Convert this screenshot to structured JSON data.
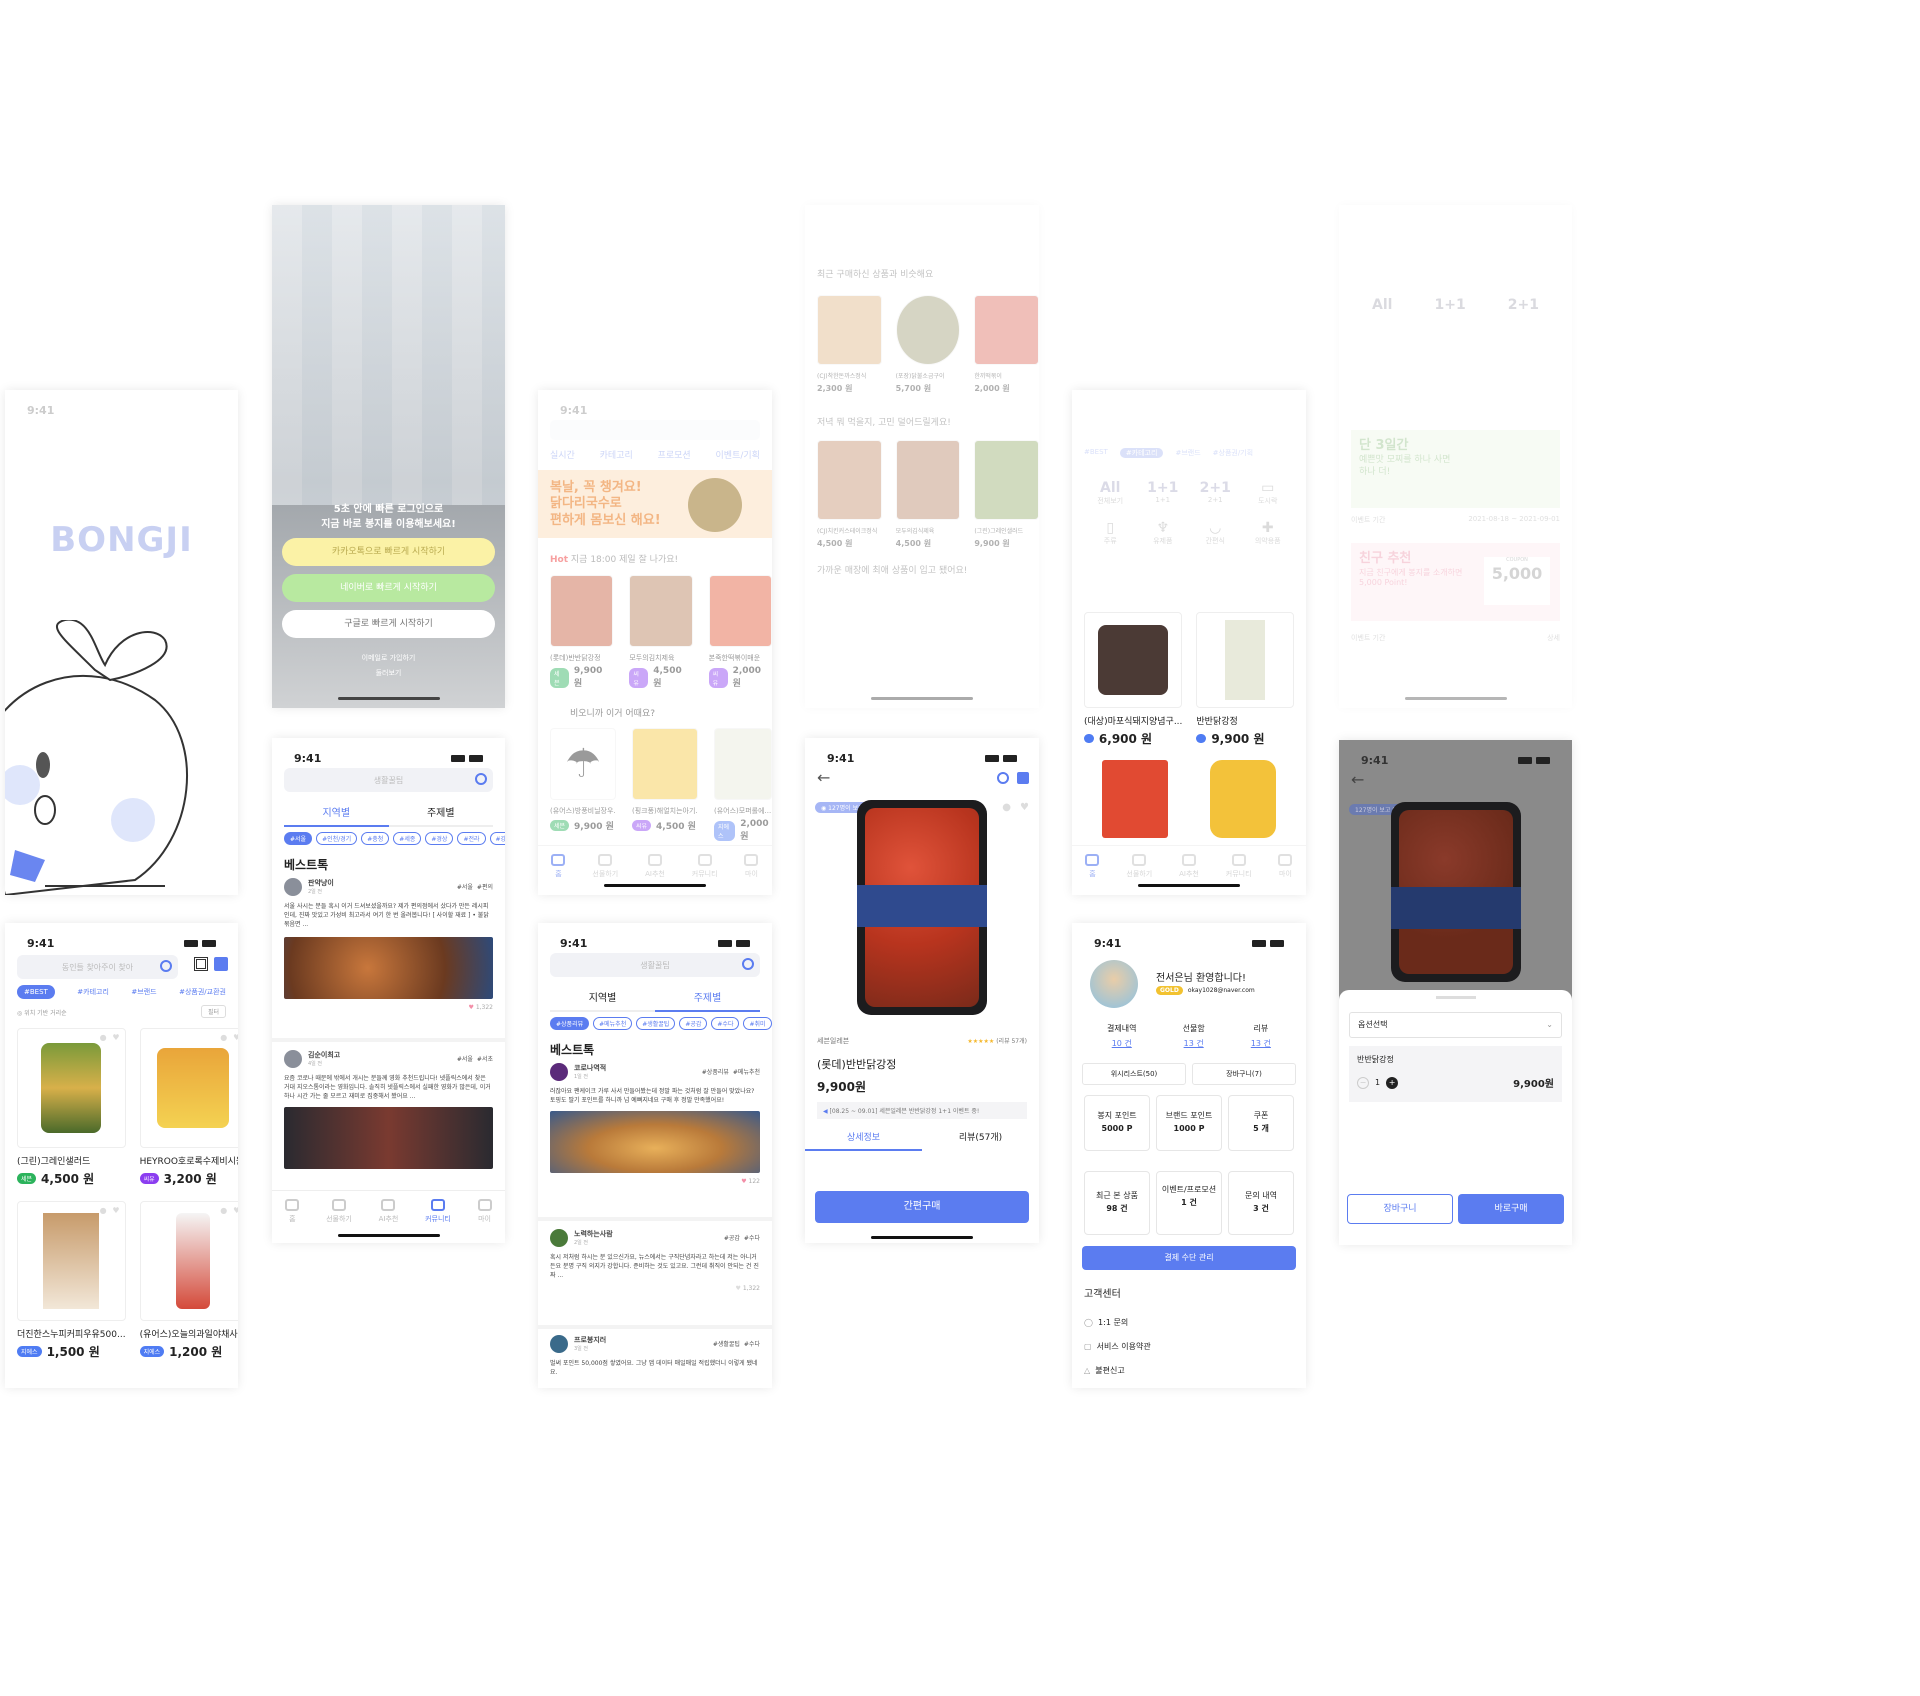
{
  "status_time": "9:41",
  "splash": {
    "logo": "BONGJI"
  },
  "login": {
    "headline1": "5초 안에 빠른 로그인으로",
    "headline2": "지금 바로 봉지를 이용해보세요!",
    "kakao": "카카오톡으로 빠르게 시작하기",
    "naver": "네이버로 빠르게 시작하기",
    "google": "구글로 빠르게 시작하기",
    "email_signup": "이메일로 가입하기",
    "browse": "둘러보기"
  },
  "home": {
    "search_placeholder": "동인들 찾아주이 찾아",
    "tabs": [
      "#BEST",
      "#카테고리",
      "#브랜드",
      "#상품권/교환권"
    ],
    "location": "위치 기반 거리순",
    "filter": "필터",
    "products": [
      {
        "name": "(그린)그레인샐러드",
        "price": "4,500 원",
        "badge": "세븐"
      },
      {
        "name": "HEYROO호로록수제비시원",
        "price": "3,200 원",
        "badge": "씨유"
      },
      {
        "name": "더진한스누피커피우유500...",
        "price": "1,500 원",
        "badge": "지에스"
      },
      {
        "name": "(유어스)오늘의과일야채사...",
        "price": "1,200 원",
        "badge": "지에스"
      }
    ]
  },
  "community": {
    "search_placeholder": "생활꿀팁",
    "tab_region": "지역별",
    "tab_topic": "주제별",
    "chips": [
      "#서울",
      "#인천/경기",
      "#충청",
      "#세종",
      "#경상",
      "#전라",
      "#강원"
    ],
    "section": "베스트톡",
    "post1": {
      "user": "판약냥이",
      "time": "2일 전",
      "tags": [
        "#서울",
        "#편의"
      ],
      "text": "서울 사시는 분들 혹시 이거 드셔보셨을까요? 제가 편의점에서 샀다가 만든 레시피인데, 진짜 맛있고 가성비 최고라서 여기 한 번 올려봅니다! [ 사이할 재료 ] • 불닭볶음면 ...",
      "likes": "1,322"
    },
    "post2": {
      "user": "김순이최고",
      "time": "4일 전",
      "tags": [
        "#서울",
        "#서초"
      ],
      "text": "요즘 코로나 때문에 밖에서 개시는 분들께 영화 추천드립니다! 넷플릭스에서 찾은 거대 지오스톰이라는 영화입니다. 솔직히 넷플릭스에서 실패한 영화가 많은데, 이거 하나 시간 가는 줄 모르고 재미로 집중해서 봤어요 ..."
    },
    "nav": [
      "홈",
      "선물하기",
      "AI추천",
      "커뮤니티",
      "마이"
    ]
  },
  "community_topic": {
    "search_placeholder": "생활꿀팁",
    "tab_region": "지역별",
    "tab_topic": "주제별",
    "chips": [
      "#상품리뷰",
      "#메뉴추천",
      "#생활꿀팁",
      "#공감",
      "#수다",
      "#취미"
    ],
    "section": "베스트톡",
    "post1": {
      "user": "코로나역적",
      "time": "1일 전",
      "tags": [
        "#상품리뷰",
        "#메뉴추천"
      ],
      "text": "러잖아요 팬케이크 가루 사서 만들어봤는데 정말 파는 것처럼 잘 만들어 맞았나요? 토핑도 딸기 포인트를 하니까 넘 예뻐지네요 구매 후 정말 만족했어요!",
      "likes": "122"
    },
    "post2": {
      "user": "노력하는사람",
      "time": "2일 전",
      "tags": [
        "#공감",
        "#수다"
      ],
      "text": "혹시 저처럼 하시는 분 있으신가요, 뉴스에서는 구직단념자라고 하는데 저는 아니거든요 분명 구직 의지가 강합니다. 준비하는 것도 있고요. 그런데 취직이 안되는 건 진짜 ...",
      "likes": "1,322"
    },
    "post3": {
      "user": "프로봉지러",
      "time": "3일 전",
      "tags": [
        "#생활꿀팁",
        "#수다"
      ],
      "text": "벌써 포인트 50,000점 쌓였어요. 그냥 앱 데이터 매일매일 적립했더니 이렇게 됐네요."
    }
  },
  "home_hot": {
    "search_placeholder": "",
    "tabs": [
      "실시간",
      "카테고리",
      "프로모션",
      "이벤트/기획"
    ],
    "banner1": "복날, 꼭 챙겨요!",
    "banner2": "닭다리국수로",
    "banner3": "편하게 몸보신 해요!",
    "hot_label": "Hot",
    "hot_title": "지금 18:00 제일 잘 나가요!",
    "hot_items": [
      {
        "name": "(롯데)반반닭강정",
        "price": "9,900 원",
        "badge": "세븐"
      },
      {
        "name": "모두의김치제육",
        "price": "4,500 원",
        "badge": "씨유"
      },
      {
        "name": "본죽한떡볶이매운",
        "price": "2,000 원",
        "badge": "씨유"
      }
    ],
    "rain_title": "비오니까 이거 어때요?",
    "rain_items": [
      {
        "name": "(유어스)방풍비닐장우...",
        "price": "9,900 원",
        "badge": "세븐"
      },
      {
        "name": "(핑크퐁)해얼치는아기...",
        "price": "4,500 원",
        "badge": "씨유"
      },
      {
        "name": "(유어스)모퍼롤에...",
        "price": "2,000 원",
        "badge": "지에스"
      }
    ]
  },
  "home_ai": {
    "recent": "최근 구매하신 상품과 비슷해요",
    "r1": {
      "name": "(CJ)착한돈까스정식",
      "price": "2,300 원"
    },
    "r2": {
      "name": "(포장)닭불소금구이",
      "price": "5,700 원"
    },
    "r3": {
      "name": "한끼떡볶이",
      "price": "2,000 원"
    },
    "dinner": "저녁 뭐 먹을지, 고민 덜어드릴게요!",
    "d1": {
      "name": "(CJ)치킨커스테이크정식",
      "price": "4,500 원"
    },
    "d2": {
      "name": "모두의김식제육",
      "price": "4,500 원"
    },
    "d3": {
      "name": "(그린)그레인샐러드",
      "price": "9,900 원"
    },
    "near": "가까운 매장에 최애 상품이 입고 됐어요!"
  },
  "home_cat": {
    "tabs": [
      "#BEST",
      "#카테고리",
      "#브랜드",
      "#상품권/기획"
    ],
    "cats": [
      "전체보기",
      "1+1",
      "2+1",
      "도시락",
      "주류",
      "유제품",
      "간편식",
      "의약용품"
    ],
    "p1": {
      "name": "(대상)마포식돼지양념구...",
      "price": "6,900 원"
    },
    "p2": {
      "name": "반반닭강정",
      "price": "9,900 원"
    }
  },
  "event": {
    "cats": [
      "All",
      "1+1",
      "2+1"
    ],
    "banner1": "단 3일간",
    "banner2": "예쁜맛 모찌를 하나 사면",
    "banner3": "하나 더!",
    "event_period": "이벤트 기간",
    "event_date": "2021-08-18 ~ 2021-09-01",
    "friend1": "친구 추천",
    "friend2": "지금 친구에게 봉지를 소개하면",
    "friend3": "5,000 Point!",
    "coupon_amount": "5,000",
    "coupon_label": "COUPON",
    "period2": "이벤트 기간",
    "detail": "상세"
  },
  "detail": {
    "viewers": "127명이 보고 있어요!",
    "store": "세븐일레븐",
    "rating": "(리뷰 57개)",
    "name": "(롯데)반반닭강정",
    "price": "9,900원",
    "notice": "[08.25 ~ 09.01] 세븐일레븐 반반닭강정 1+1 이벤트 중!",
    "tab_info": "상세정보",
    "tab_review": "리뷰(57개)",
    "buy": "간편구매"
  },
  "option": {
    "viewers": "127명이 보고 있어요!",
    "select": "옵션선택",
    "item": "반반닭강정",
    "qty": "1",
    "price": "9,900원",
    "cart": "장바구니",
    "buy_now": "바로구매"
  },
  "mypage": {
    "welcome": "전서은님 환영합니다!",
    "grade": "GOLD",
    "email": "okay1028@naver.com",
    "stats": [
      {
        "label": "결제내역",
        "value": "10 건"
      },
      {
        "label": "선물함",
        "value": "13 건"
      },
      {
        "label": "리뷰",
        "value": "13 건"
      }
    ],
    "wishlist": "위시리스트(50)",
    "cart": "장바구니(7)",
    "cells": [
      {
        "label": "봉지 포인트",
        "value": "5000 P"
      },
      {
        "label": "브랜드 포인트",
        "value": "1000 P"
      },
      {
        "label": "쿠폰",
        "value": "5 개"
      },
      {
        "label": "최근 본 상품",
        "value": "98 건"
      },
      {
        "label": "이벤트/프로모션",
        "value": "1 건"
      },
      {
        "label": "문의 내역",
        "value": "3 건"
      }
    ],
    "pay": "결제 수단 관리",
    "cs": "고객센터",
    "cs_items": [
      "1:1 문의",
      "서비스 이용약관",
      "불편신고"
    ]
  }
}
